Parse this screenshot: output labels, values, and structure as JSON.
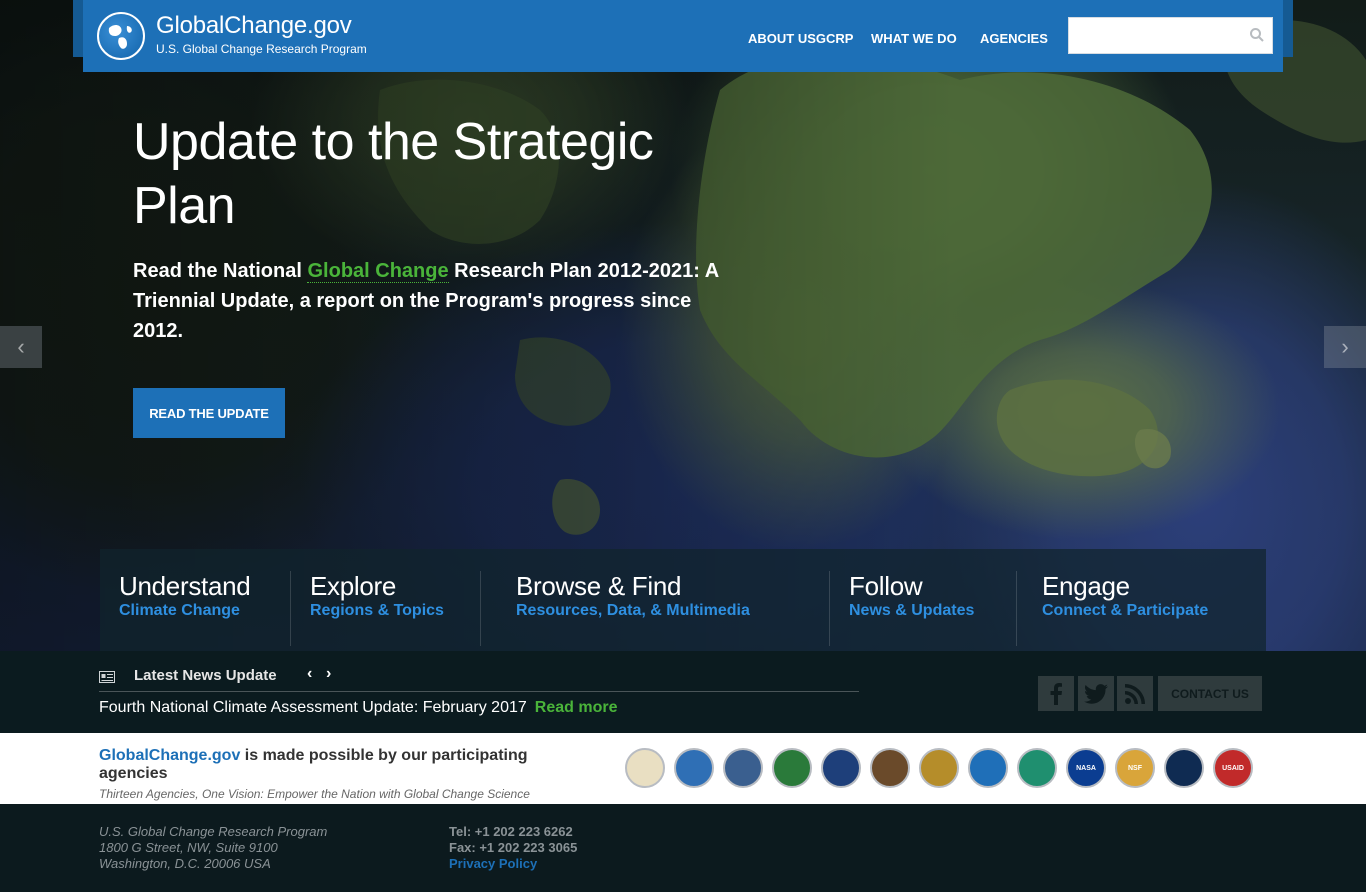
{
  "header": {
    "brand_title": "GlobalChange.gov",
    "brand_subtitle": "U.S. Global Change Research Program",
    "nav": [
      "ABOUT USGCRP",
      "WHAT WE DO",
      "AGENCIES"
    ],
    "search_placeholder": "",
    "logo_icon": "globe-icon",
    "search_icon": "search-icon"
  },
  "hero": {
    "title": "Update to the Strategic Plan",
    "desc_pre": "Read the National ",
    "desc_highlight": "Global Change",
    "desc_post": " Research Plan 2012-2021: A Triennial Update, a report on the Program's progress since 2012.",
    "button": "READ THE UPDATE",
    "prev_arrow": "‹",
    "next_arrow": "›"
  },
  "categories": [
    {
      "title": "Understand",
      "sub": "Climate Change"
    },
    {
      "title": "Explore",
      "sub": "Regions & Topics"
    },
    {
      "title": "Browse & Find",
      "sub": "Resources, Data, & Multimedia"
    },
    {
      "title": "Follow",
      "sub": "News & Updates"
    },
    {
      "title": "Engage",
      "sub": "Connect & Participate"
    }
  ],
  "news": {
    "label": "Latest News Update",
    "item": "Fourth National Climate Assessment Update: February 2017",
    "read_more": "Read more",
    "prev": "‹",
    "next": "›",
    "contact": "CONTACT US",
    "social_icons": [
      "facebook-icon",
      "twitter-icon",
      "rss-icon"
    ]
  },
  "agencies": {
    "brand": "GlobalChange.gov",
    "text": " is made possible by our participating agencies",
    "tagline": "Thirteen Agencies, One Vision: Empower the Nation with Global Change Science",
    "seals": [
      {
        "name": "usda-seal",
        "color": "#e9dfc2"
      },
      {
        "name": "commerce-seal",
        "color": "#2f6fb5"
      },
      {
        "name": "defense-seal",
        "color": "#3a5f8f"
      },
      {
        "name": "energy-seal",
        "color": "#2a7a3a"
      },
      {
        "name": "hhs-seal",
        "color": "#1e3f7a"
      },
      {
        "name": "interior-seal",
        "color": "#6a4a2a"
      },
      {
        "name": "state-seal",
        "color": "#b58d2a"
      },
      {
        "name": "transportation-seal",
        "color": "#1f6fb8"
      },
      {
        "name": "epa-seal",
        "color": "#1f8f6f"
      },
      {
        "name": "nasa-seal",
        "color": "#0b3d91"
      },
      {
        "name": "nsf-seal",
        "color": "#d9a53a"
      },
      {
        "name": "smithsonian-seal",
        "color": "#0f2b52"
      },
      {
        "name": "usaid-seal",
        "color": "#c12a2a"
      }
    ],
    "nasa_label": "NASA",
    "nsf_label": "NSF",
    "usaid_label": "USAID"
  },
  "footer": {
    "addr1": "U.S. Global Change Research Program",
    "addr2": "1800 G Street, NW, Suite 9100",
    "addr3": "Washington, D.C. 20006 USA",
    "tel": "Tel: +1 202 223 6262",
    "fax": "Fax: +1 202 223 3065",
    "privacy": "Privacy Policy"
  }
}
